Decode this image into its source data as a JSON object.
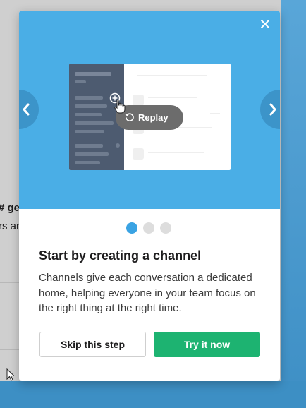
{
  "background": {
    "partial_text_1": "# ge",
    "partial_text_2": "rs ar"
  },
  "modal": {
    "close_icon": "close-icon",
    "prev_icon": "chevron-left-icon",
    "next_icon": "chevron-right-icon",
    "preview": {
      "replay_label": "Replay",
      "replay_icon": "replay-icon"
    },
    "pager": {
      "count": 3,
      "active_index": 0
    },
    "title": "Start by creating a channel",
    "description": "Channels give each conversation a dedicated home, helping everyone in your team focus on the right thing at the right time.",
    "skip_label": "Skip this step",
    "try_label": "Try it now"
  },
  "colors": {
    "hero_bg": "#4aaee6",
    "primary_green": "#1db371",
    "active_dot": "#3aa3e3",
    "sidebar_preview": "#4d5b70"
  }
}
